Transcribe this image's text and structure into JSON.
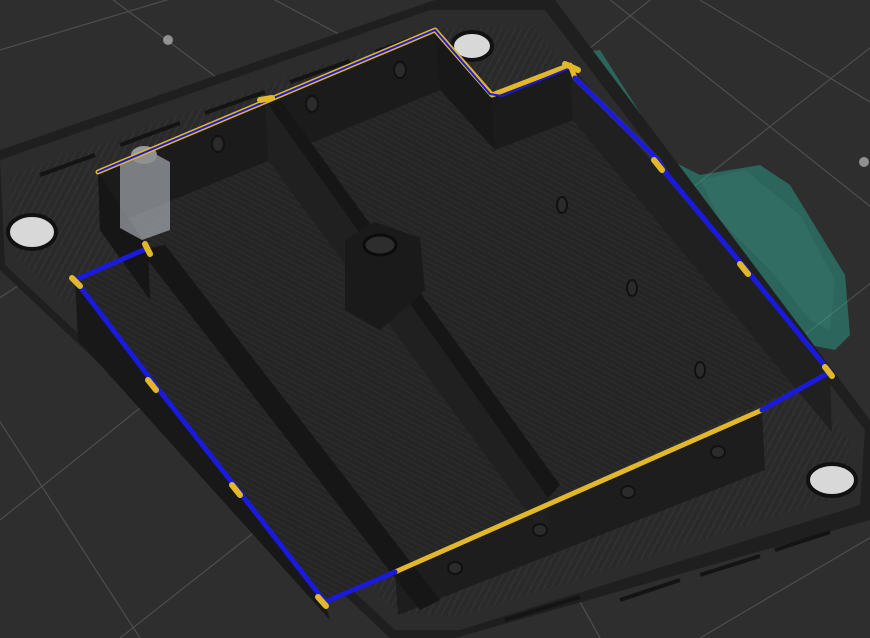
{
  "app": {
    "view": "sliced-layer-preview"
  },
  "colors": {
    "background": "#2e2e2e",
    "bed_grid": "#5a5a5a",
    "plate": "#262626",
    "plate_top": "#303030",
    "wall": "#1c1c1c",
    "wall_face": "#3a3a3a",
    "outer_perimeter": "#1a1adc",
    "inner_perimeter": "#e2b72a",
    "support_ghost": "#3fc7b0",
    "object_ghost": "#d9dde4"
  },
  "icons": {
    "bed_grid": "grid-lines",
    "model": "enclosure-box"
  }
}
